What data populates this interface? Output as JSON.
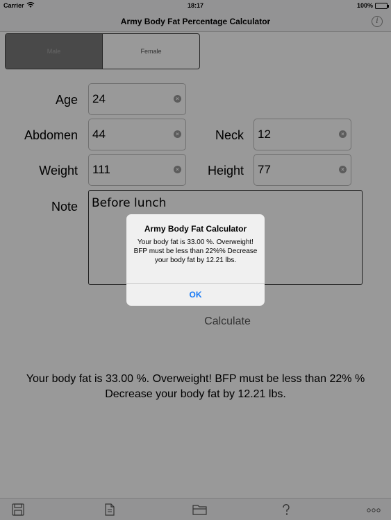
{
  "status_bar": {
    "carrier": "Carrier",
    "time": "18:17",
    "battery": "100%"
  },
  "nav": {
    "title": "Army Body Fat Percentage Calculator"
  },
  "gender": {
    "options": [
      "Male",
      "Female"
    ],
    "selected": "Male"
  },
  "form": {
    "age_label": "Age",
    "age_value": "24",
    "abdomen_label": "Abdomen",
    "abdomen_value": "44",
    "neck_label": "Neck",
    "neck_value": "12",
    "weight_label": "Weight",
    "weight_value": "111",
    "height_label": "Height",
    "height_value": "77",
    "note_label": "Note",
    "note_value": "Before lunch"
  },
  "calculate_label": "Calculate",
  "result_text": "Your body fat is 33.00 %.   Overweight!   BFP must be less than 22% %   Decrease your body fat by 12.21 lbs.",
  "alert": {
    "title": "Army Body Fat Calculator",
    "message": "Your body fat is 33.00 %.   Overweight!   BFP must be less than 22%%   Decrease your body fat by 12.21 lbs.",
    "ok_label": "OK"
  },
  "toolbar": {
    "icons": [
      "save-icon",
      "document-icon",
      "folder-icon",
      "help-icon",
      "more-icon"
    ]
  },
  "colors": {
    "accent": "#1779f5",
    "segment_selected": "#7a7a7a"
  }
}
